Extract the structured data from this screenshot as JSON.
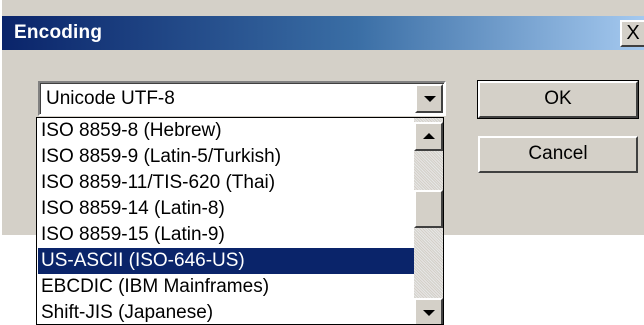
{
  "dialog": {
    "title": "Encoding",
    "close_label": "X",
    "ok_label": "OK",
    "cancel_label": "Cancel"
  },
  "combo": {
    "selected_value": "Unicode UTF-8",
    "dropdown_icon": "chevron-down-icon"
  },
  "list": {
    "items": [
      "ISO 8859-8 (Hebrew)",
      "ISO 8859-9 (Latin-5/Turkish)",
      "ISO 8859-11/TIS-620 (Thai)",
      "ISO 8859-14 (Latin-8)",
      "ISO 8859-15 (Latin-9)",
      "US-ASCII (ISO-646-US)",
      "EBCDIC (IBM Mainframes)",
      "Shift-JIS (Japanese)"
    ],
    "highlighted_index": 5
  },
  "colors": {
    "title_gradient_start": "#0a246a",
    "title_gradient_end": "#a6caf0",
    "selection": "#0a246a",
    "face": "#d4d0c8"
  }
}
